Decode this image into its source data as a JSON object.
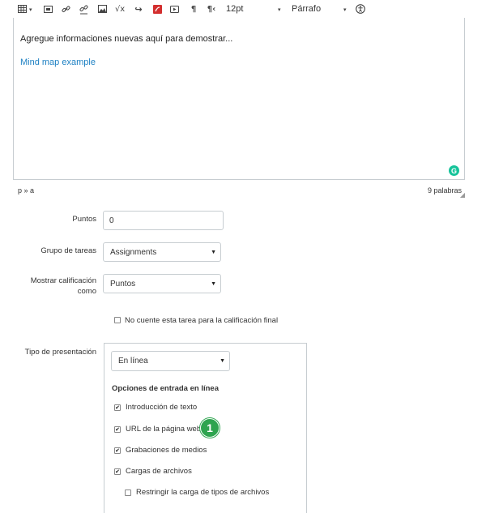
{
  "toolbar": {
    "icons": [
      "table-icon",
      "media-icon",
      "link-icon",
      "unlink-icon",
      "image-icon",
      "equation-icon",
      "lti-tool-icon",
      "flash-icon",
      "video-icon",
      "ltr-icon",
      "rtl-icon"
    ],
    "font_size": "12pt",
    "format": "Párrafo",
    "accessibility_icon": "accessibility-icon"
  },
  "editor": {
    "text": "Agregue informaciones nuevas aquí para demostrar...",
    "link": "Mind map example",
    "grammarly": "G"
  },
  "statusbar": {
    "path": "p » a",
    "word_count": "9 palabras"
  },
  "form": {
    "points_label": "Puntos",
    "points_value": "0",
    "group_label": "Grupo de tareas",
    "group_value": "Assignments",
    "display_label": "Mostrar calificación como",
    "display_value": "Puntos",
    "exclude_label": "No cuente esta tarea para la calificación final",
    "submission_label": "Tipo de presentación",
    "submission_value": "En línea",
    "online_heading": "Opciones de entrada en línea",
    "options": [
      {
        "label": "Introducción de texto",
        "checked": true
      },
      {
        "label": "URL de la página web",
        "checked": true
      },
      {
        "label": "Grabaciones de medios",
        "checked": true
      },
      {
        "label": "Cargas de archivos",
        "checked": true
      }
    ],
    "restrict_label": "Restringir la carga de tipos de archivos"
  },
  "callout": "1"
}
